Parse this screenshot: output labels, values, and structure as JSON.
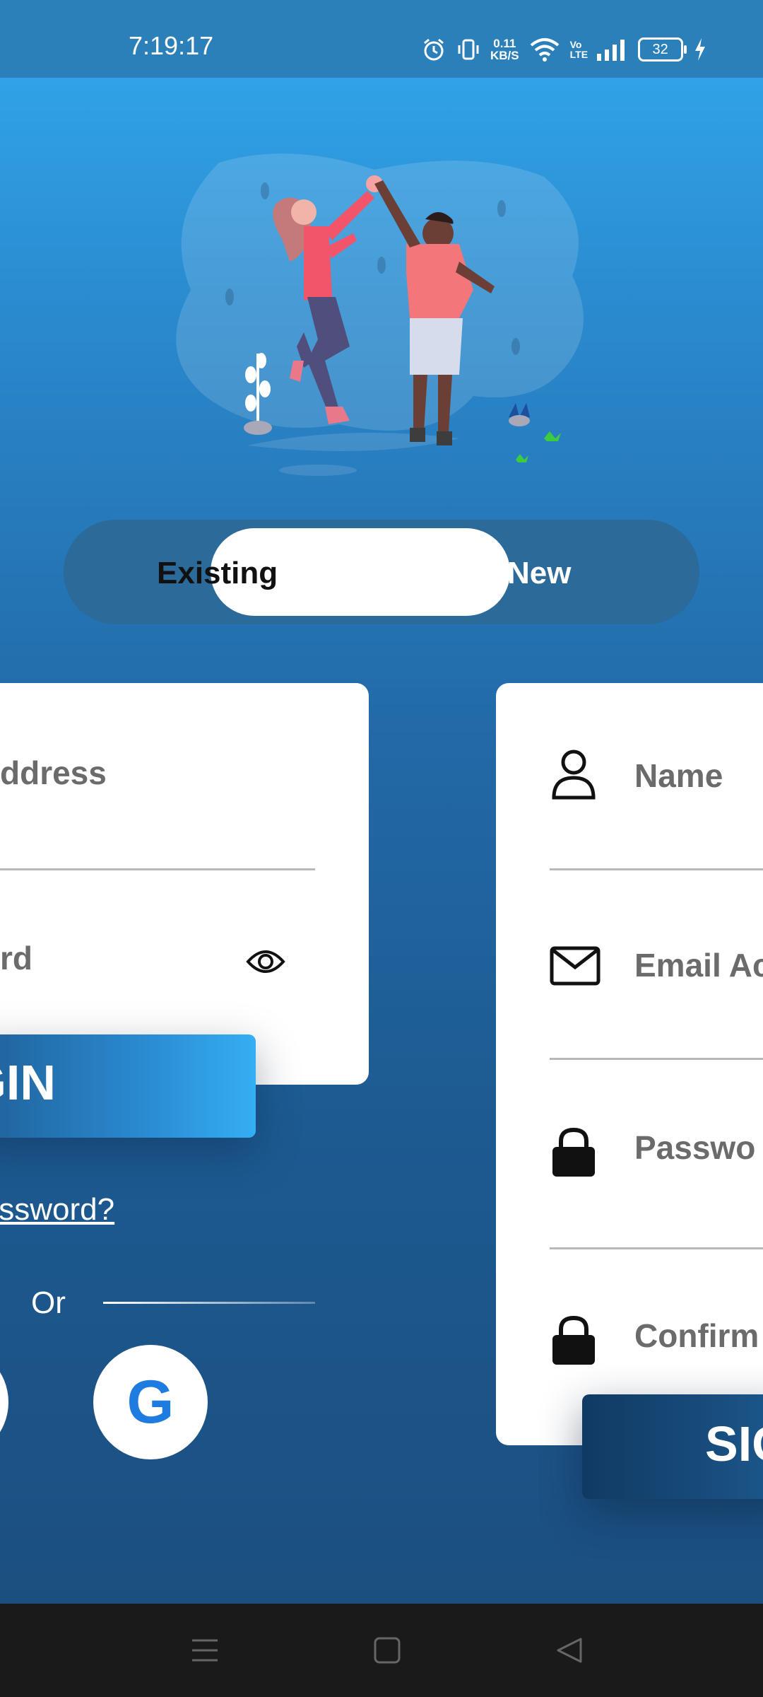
{
  "status_bar": {
    "time": "7:19:17",
    "net_speed_value": "0.11",
    "net_speed_unit": "KB/S",
    "volte": "Vo LTE",
    "battery": "32"
  },
  "toggle": {
    "existing_label": "Existing",
    "new_label": "New"
  },
  "login_form": {
    "email_placeholder": "ddress",
    "password_placeholder": "rd",
    "login_label": "OGIN",
    "forgot_label": "t Password?",
    "or_label": "Or",
    "google_label": "G"
  },
  "signup_form": {
    "name_placeholder": "Name",
    "email_placeholder": "Email Ac",
    "password_placeholder": "Passwo",
    "confirm_placeholder": "Confirm",
    "signup_label": "SIG"
  },
  "colors": {
    "accent": "#2a8ad0",
    "google_blue": "#1e7be0"
  }
}
